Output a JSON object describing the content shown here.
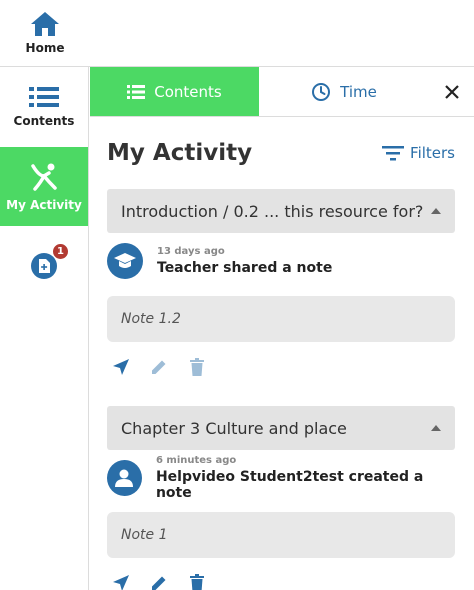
{
  "nav": {
    "home_label": "Home",
    "contents_label": "Contents",
    "activity_label": "My Activity",
    "notes_badge": "1"
  },
  "tabs": {
    "contents_label": "Contents",
    "time_label": "Time"
  },
  "main": {
    "title": "My Activity",
    "filters_label": "Filters"
  },
  "groups": [
    {
      "section": "Introduction / 0.2 ... this resource for?",
      "time_ago": "13 days ago",
      "message": "Teacher shared a note",
      "note": "Note 1.2",
      "avatar_icon": "graduation-cap-icon"
    },
    {
      "section": "Chapter 3 Culture and place",
      "time_ago": "6 minutes ago",
      "message": "Helpvideo Student2test created a note",
      "note": "Note 1",
      "avatar_icon": "user-icon"
    }
  ],
  "colors": {
    "accent_green": "#4cd964",
    "brand_blue": "#2a6ea8",
    "badge_red": "#b23a32"
  }
}
